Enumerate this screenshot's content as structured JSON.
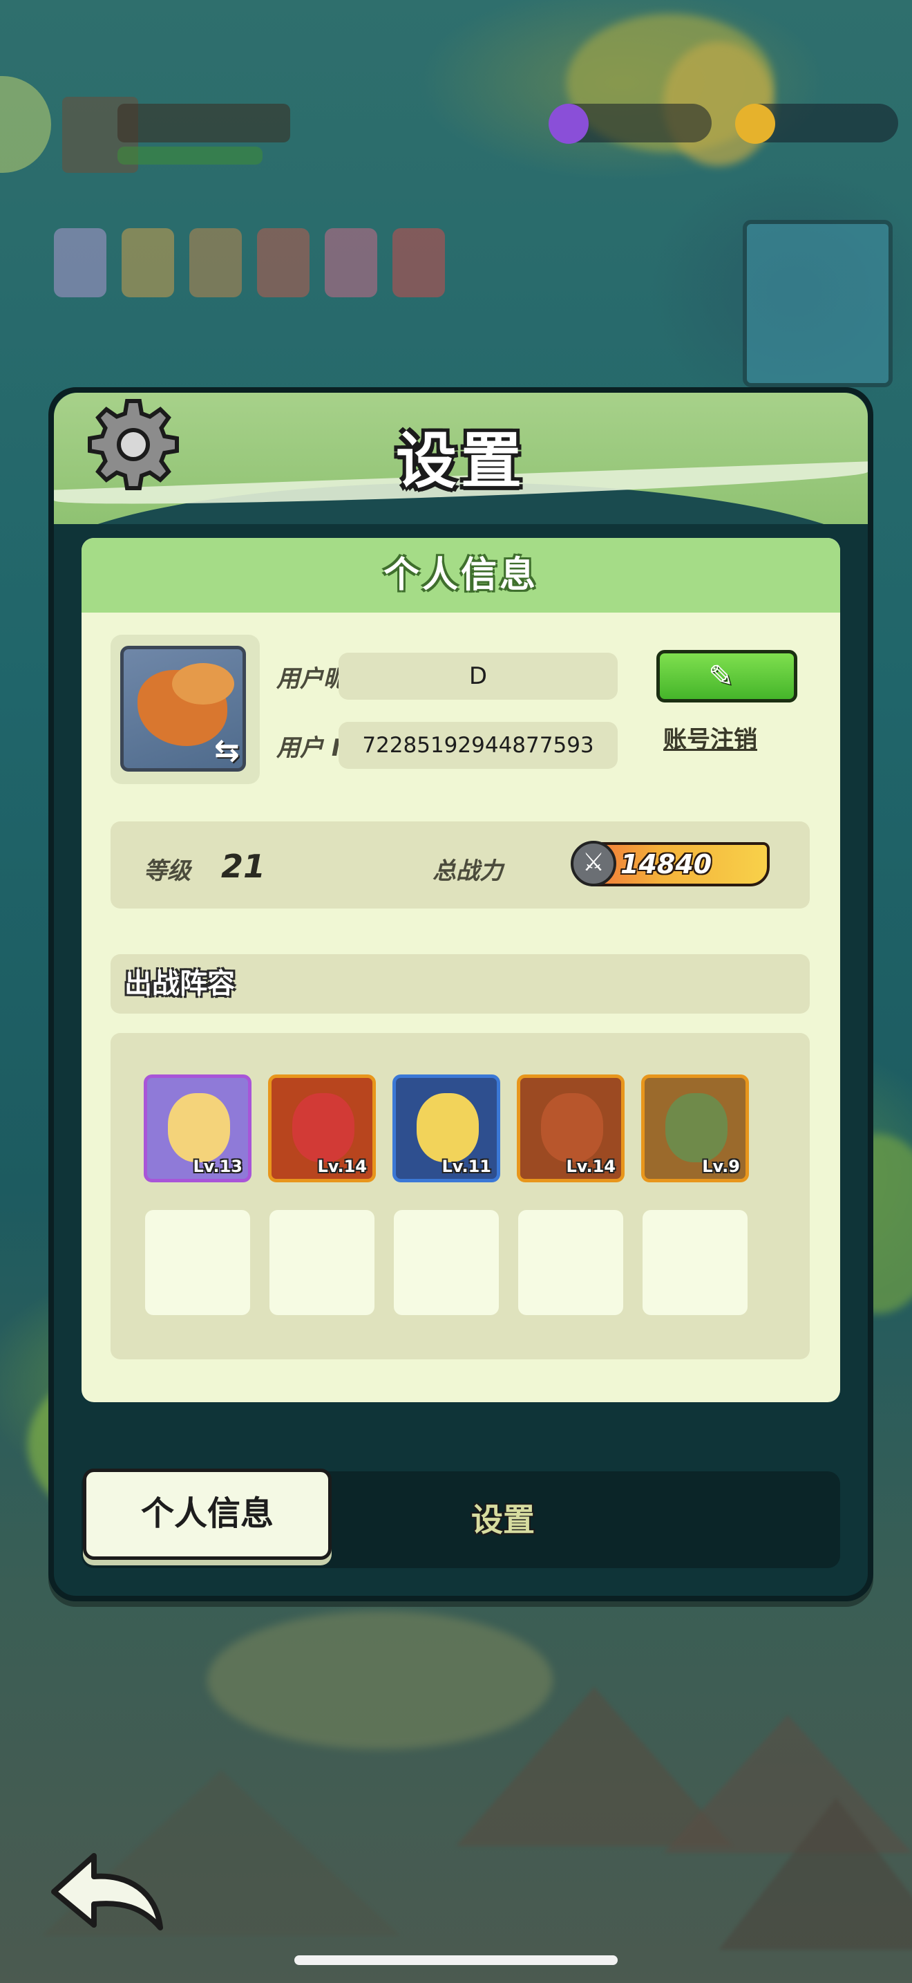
{
  "panel": {
    "title": "设置"
  },
  "card": {
    "header": "个人信息",
    "nickname_label": "用户昵称",
    "nickname_value": "D",
    "userid_label": "用户 ID",
    "userid_value": "72285192944877593",
    "deregister_link": "账号注销",
    "level_label": "等级",
    "level_value": "21",
    "power_label": "总战力",
    "power_value": "14840",
    "lineup_title": "出战阵容",
    "heroes": [
      {
        "level": "Lv.13",
        "frame": "#a855d8",
        "bg": "#8f7ad8",
        "face": "#f4d37a"
      },
      {
        "level": "Lv.14",
        "frame": "#e8961c",
        "bg": "#b8451e",
        "face": "#d23a36"
      },
      {
        "level": "Lv.11",
        "frame": "#3b78d6",
        "bg": "#2e4f8f",
        "face": "#f2d35a"
      },
      {
        "level": "Lv.14",
        "frame": "#e8961c",
        "bg": "#9c4a22",
        "face": "#b8562c"
      },
      {
        "level": "Lv.9",
        "frame": "#e8961c",
        "bg": "#9b6a2c",
        "face": "#6f8a4a"
      }
    ]
  },
  "tabs": {
    "active": "个人信息",
    "other": "设置"
  },
  "icons": {
    "gear": "gear-icon",
    "edit": "pencil-icon",
    "power": "crossed-swords-icon",
    "back": "back-arrow-icon",
    "swap": "swap-icon"
  }
}
